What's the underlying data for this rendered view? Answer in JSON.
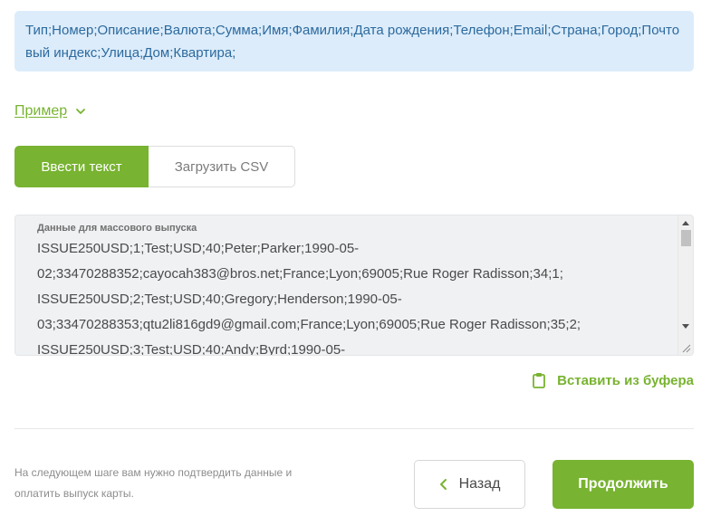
{
  "format_info": {
    "text": "Тип;Номер;Описание;Валюта;Сумма;Имя;Фамилия;Дата рождения;Телефон;Email;Страна;Город;Почтовый индекс;Улица;Дом;Квартира;"
  },
  "example_toggle": {
    "label": "Пример",
    "icon": "chevron-down-icon"
  },
  "tabs": [
    {
      "label": "Ввести текст",
      "active": true
    },
    {
      "label": "Загрузить CSV",
      "active": false
    }
  ],
  "bulk_input": {
    "label": "Данные для массового выпуска",
    "lines": [
      "ISSUE250USD;1;Test;USD;40;Peter;Parker;1990-05-",
      "02;33470288352;cayocah383@bros.net;France;Lyon;69005;Rue Roger Radisson;34;1;",
      "ISSUE250USD;2;Test;USD;40;Gregory;Henderson;1990-05-",
      "03;33470288353;qtu2li816gd9@gmail.com;France;Lyon;69005;Rue Roger Radisson;35;2;",
      "ISSUE250USD;3;Test;USD;40;Andy;Byrd;1990-05-"
    ]
  },
  "paste_button": {
    "label": "Вставить из буфера",
    "icon": "clipboard-icon"
  },
  "footer": {
    "hint": "На следующем шаге вам нужно подтвердить данные и оплатить выпуск карты.",
    "back_label": "Назад",
    "continue_label": "Продолжить"
  },
  "colors": {
    "accent": "#78b331",
    "info_bg": "#dcecfb",
    "info_text": "#2c6a9e"
  }
}
